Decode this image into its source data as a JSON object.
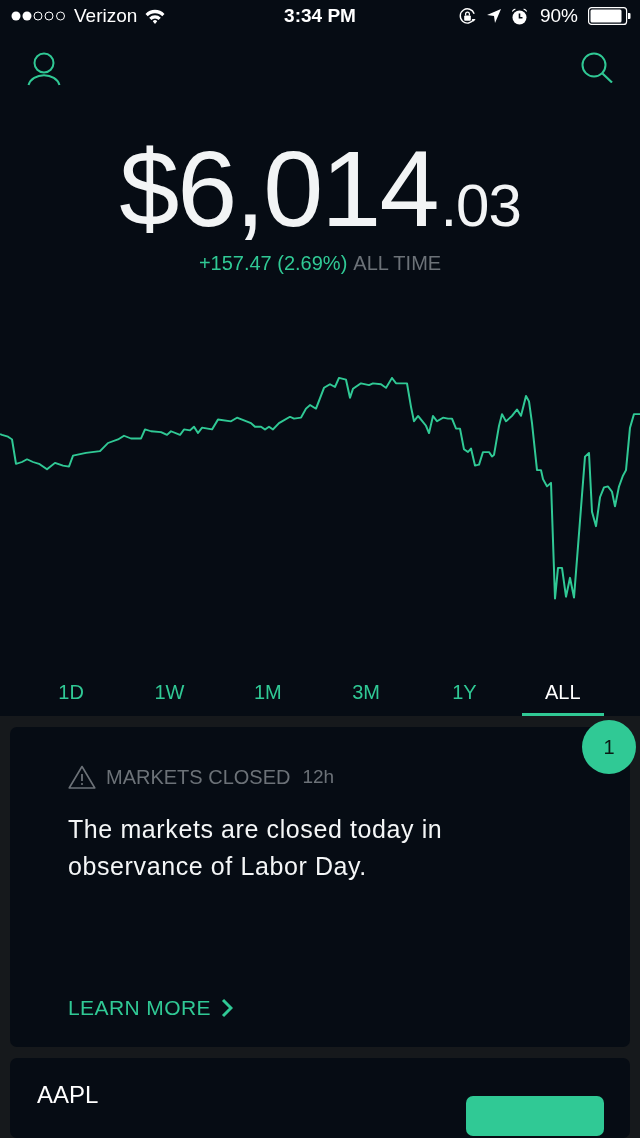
{
  "status_bar": {
    "carrier": "Verizon",
    "time": "3:34 PM",
    "battery": "90%"
  },
  "portfolio": {
    "value": "$6,014",
    "value_cents": ".03",
    "change": "+157.47 (2.69%)",
    "period": "ALL TIME"
  },
  "ranges": [
    {
      "label": "1D",
      "selected": false
    },
    {
      "label": "1W",
      "selected": false
    },
    {
      "label": "1M",
      "selected": false
    },
    {
      "label": "3M",
      "selected": false
    },
    {
      "label": "1Y",
      "selected": false
    },
    {
      "label": "ALL",
      "selected": true
    }
  ],
  "cards": [
    {
      "kind": "alert",
      "badge": "1",
      "title": "MARKETS CLOSED",
      "age": "12h",
      "message": "The markets are closed today in observance of Labor Day.",
      "action": "LEARN MORE"
    },
    {
      "kind": "stock",
      "symbol": "AAPL"
    }
  ]
}
